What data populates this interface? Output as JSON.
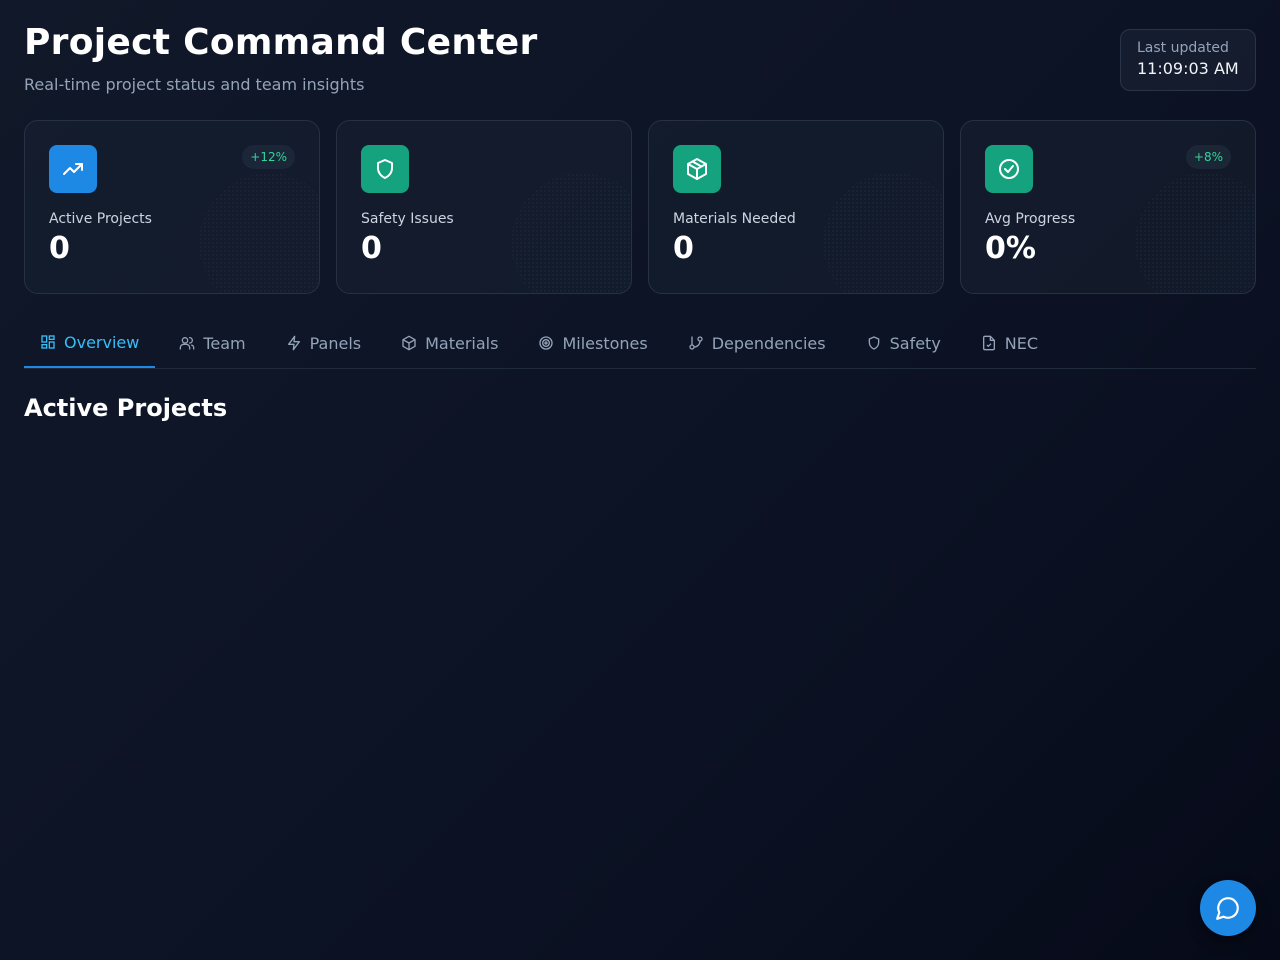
{
  "header": {
    "title": "Project Command Center",
    "subtitle": "Real-time project status and team insights",
    "last_updated_label": "Last updated",
    "last_updated_time": "11:09:03 AM"
  },
  "stats": [
    {
      "label": "Active Projects",
      "value": "0",
      "badge": "+12%",
      "icon": "trending-up-icon",
      "color": "#1e88e5"
    },
    {
      "label": "Safety Issues",
      "value": "0",
      "badge": "",
      "icon": "shield-icon",
      "color": "#15a27e"
    },
    {
      "label": "Materials Needed",
      "value": "0",
      "badge": "",
      "icon": "package-icon",
      "color": "#15a27e"
    },
    {
      "label": "Avg Progress",
      "value": "0%",
      "badge": "+8%",
      "icon": "check-circle-icon",
      "color": "#15a27e"
    }
  ],
  "tabs": [
    {
      "label": "Overview",
      "icon": "layout-grid-icon",
      "active": true
    },
    {
      "label": "Team",
      "icon": "users-icon"
    },
    {
      "label": "Panels",
      "icon": "zap-icon"
    },
    {
      "label": "Materials",
      "icon": "package-icon"
    },
    {
      "label": "Milestones",
      "icon": "target-icon"
    },
    {
      "label": "Dependencies",
      "icon": "git-branch-icon"
    },
    {
      "label": "Safety",
      "icon": "shield-icon"
    },
    {
      "label": "NEC",
      "icon": "file-check-icon"
    }
  ],
  "main": {
    "section_title": "Active Projects"
  },
  "chat": {
    "icon": "message-circle-icon"
  },
  "colors": {
    "accent": "#1e88e5",
    "success": "#15a27e",
    "active_tab": "#38bdf8",
    "badge_text": "#34d399"
  }
}
